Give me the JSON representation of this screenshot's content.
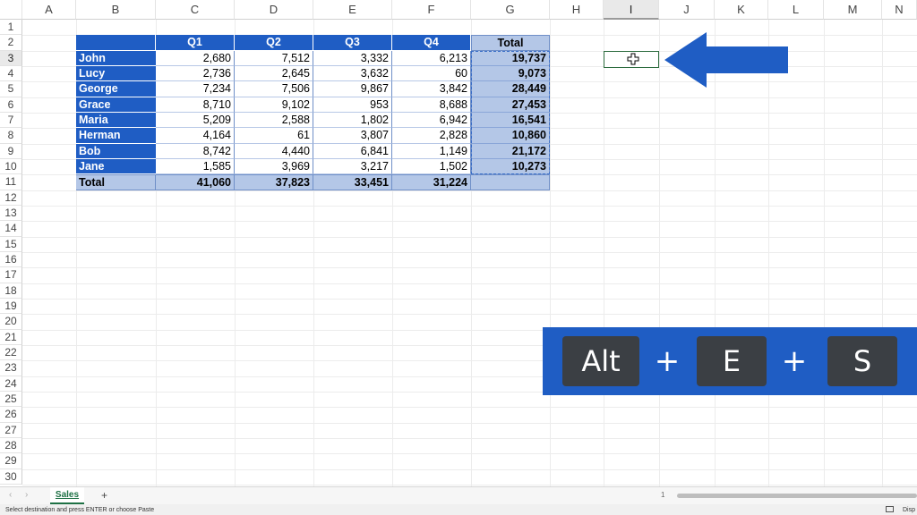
{
  "columns": [
    "A",
    "B",
    "C",
    "D",
    "E",
    "F",
    "G",
    "H",
    "I",
    "J",
    "K",
    "L",
    "M",
    "N"
  ],
  "rows": [
    "1",
    "2",
    "3",
    "4",
    "5",
    "6",
    "7",
    "8",
    "9",
    "10",
    "11",
    "12",
    "13",
    "14",
    "15",
    "16",
    "17",
    "18",
    "19",
    "20",
    "21",
    "22",
    "23",
    "24",
    "25",
    "26",
    "27",
    "28",
    "29",
    "30"
  ],
  "table": {
    "headers": [
      "Q1",
      "Q2",
      "Q3",
      "Q4",
      "Total"
    ],
    "names": [
      "John",
      "Lucy",
      "George",
      "Grace",
      "Maria",
      "Herman",
      "Bob",
      "Jane"
    ],
    "values": [
      [
        "2,680",
        "7,512",
        "3,332",
        "6,213",
        "19,737"
      ],
      [
        "2,736",
        "2,645",
        "3,632",
        "60",
        "9,073"
      ],
      [
        "7,234",
        "7,506",
        "9,867",
        "3,842",
        "28,449"
      ],
      [
        "8,710",
        "9,102",
        "953",
        "8,688",
        "27,453"
      ],
      [
        "5,209",
        "2,588",
        "1,802",
        "6,942",
        "16,541"
      ],
      [
        "4,164",
        "61",
        "3,807",
        "2,828",
        "10,860"
      ],
      [
        "8,742",
        "4,440",
        "6,841",
        "1,149",
        "21,172"
      ],
      [
        "1,585",
        "3,969",
        "3,217",
        "1,502",
        "10,273"
      ]
    ],
    "total_label": "Total",
    "totals": [
      "41,060",
      "37,823",
      "33,451",
      "31,224",
      ""
    ]
  },
  "selected_column": "I",
  "selected_row": "3",
  "shortcut": {
    "keys": [
      "Alt",
      "E",
      "S"
    ],
    "separator": "+"
  },
  "sheet_tabs": {
    "active": "Sales",
    "add": "+",
    "prev": "‹",
    "next": "›"
  },
  "status": {
    "message": "Select destination and press ENTER or choose Paste",
    "page": "1",
    "right": "Disp"
  },
  "colors": {
    "header_blue": "#1f5dc4",
    "total_fill": "#b4c7e7",
    "banner": "#1f5dc4",
    "key_bg": "#3b3f44"
  },
  "icons": {
    "cursor": "plus-cursor-icon",
    "arrow": "left-arrow-icon"
  }
}
